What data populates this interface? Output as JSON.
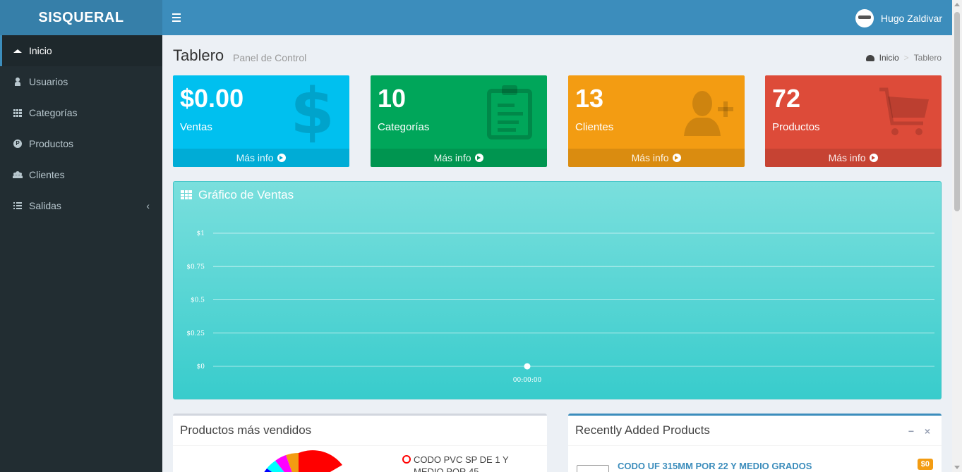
{
  "app": {
    "title": "SISQUERAL"
  },
  "header": {
    "user_name": "Hugo Zaldivar"
  },
  "sidebar": {
    "items": [
      {
        "label": "Inicio",
        "icon": "home-icon"
      },
      {
        "label": "Usuarios",
        "icon": "user-icon"
      },
      {
        "label": "Categorías",
        "icon": "grid-icon"
      },
      {
        "label": "Productos",
        "icon": "product-p-icon"
      },
      {
        "label": "Clientes",
        "icon": "users-icon"
      },
      {
        "label": "Salidas",
        "icon": "list-icon",
        "chevron": "‹"
      }
    ]
  },
  "page": {
    "title": "Tablero",
    "subtitle": "Panel de Control",
    "breadcrumb": [
      "Inicio",
      "Tablero"
    ],
    "breadcrumb_sep": ">"
  },
  "cards": [
    {
      "value": "$0.00",
      "label": "Ventas",
      "footer": "Más info",
      "color": "#00c0ef",
      "icon": "dollar-icon"
    },
    {
      "value": "10",
      "label": "Categorías",
      "footer": "Más info",
      "color": "#00a65a",
      "icon": "clipboard-icon"
    },
    {
      "value": "13",
      "label": "Clientes",
      "footer": "Más info",
      "color": "#f39c12",
      "icon": "user-plus-icon"
    },
    {
      "value": "72",
      "label": "Productos",
      "footer": "Más info",
      "color": "#dd4b39",
      "icon": "shopping-cart-icon"
    }
  ],
  "sales_chart": {
    "title": "Gráfico de Ventas",
    "chart_data": {
      "type": "line",
      "x": [
        "00:00:00"
      ],
      "series": [
        {
          "values": [
            0
          ]
        }
      ],
      "ytick_labels": [
        "$0",
        "$0.25",
        "$0.5",
        "$0.75",
        "$1"
      ],
      "yticks": [
        0,
        0.25,
        0.5,
        0.75,
        1
      ],
      "ylim": [
        0,
        1
      ],
      "grid": true,
      "color": "#ffffff"
    }
  },
  "top_products": {
    "title": "Productos más vendidos",
    "legend": [
      "CODO PVC SP DE 1 Y MEDIO POR 45"
    ]
  },
  "recent_products": {
    "title": "Recently Added Products",
    "minimize": "−",
    "close": "×",
    "items": [
      {
        "name": "CODO UF 315MM POR 22 Y MEDIO GRADOS",
        "price": "$0"
      }
    ]
  }
}
